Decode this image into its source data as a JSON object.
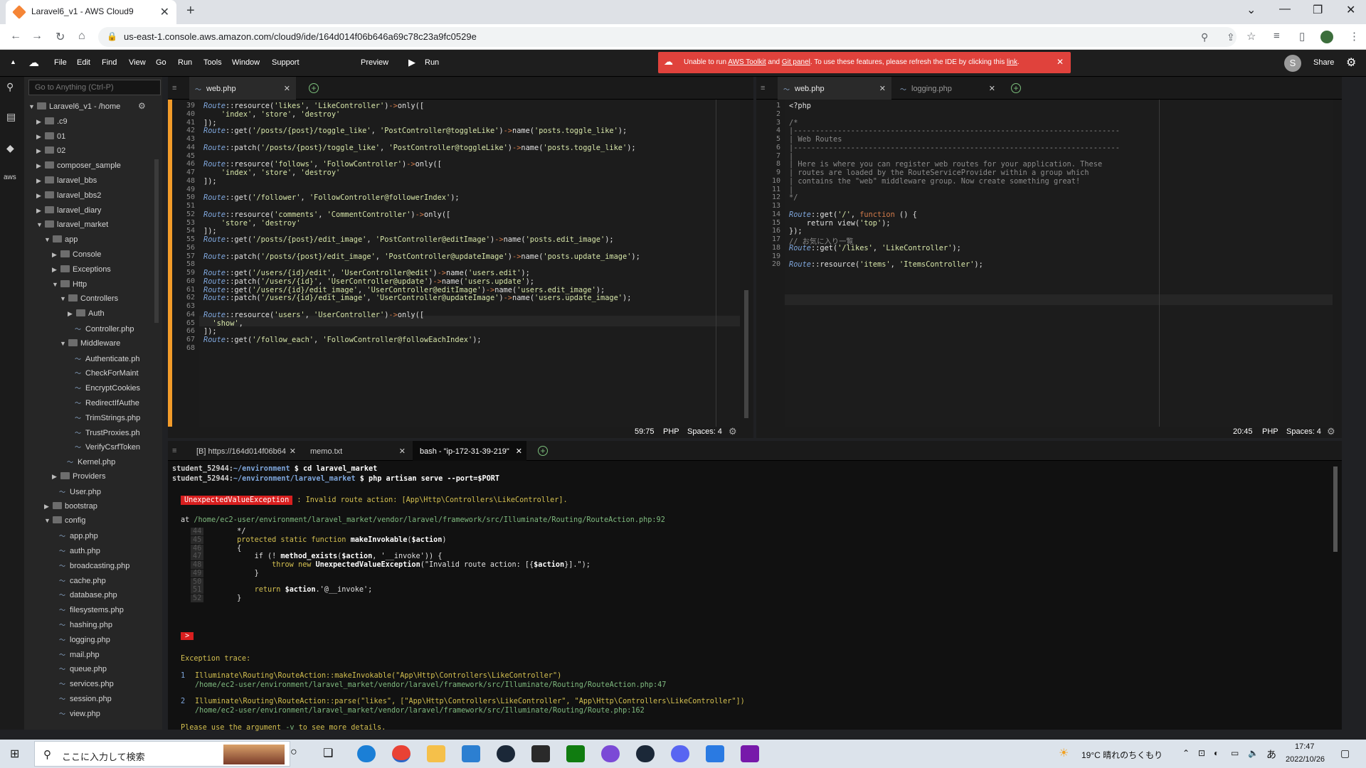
{
  "browser": {
    "tab_title": "Laravel6_v1 - AWS Cloud9",
    "url": "us-east-1.console.aws.amazon.com/cloud9/ide/164d014f06b646a69c78c23a9fc0529e"
  },
  "ide": {
    "menu": [
      "File",
      "Edit",
      "Find",
      "View",
      "Go",
      "Run",
      "Tools",
      "Window",
      "Support"
    ],
    "preview_label": "Preview",
    "run_label": "Run",
    "share_label": "Share",
    "avatar_letter": "S",
    "banner": {
      "prefix": "Unable to run ",
      "link1": "AWS Toolkit",
      "mid": " and ",
      "link2": "Git panel",
      "suffix": ". To use these features, please refresh the IDE by clicking this ",
      "link3": "link",
      "end": "."
    },
    "goto_placeholder": "Go to Anything (Ctrl-P)",
    "aws_label": "aws"
  },
  "tree": [
    {
      "label": "Laravel6_v1 - /home",
      "type": "folder",
      "depth": 0,
      "open": true
    },
    {
      "label": ".c9",
      "type": "folder",
      "depth": 1,
      "open": false
    },
    {
      "label": "01",
      "type": "folder",
      "depth": 1,
      "open": false
    },
    {
      "label": "02",
      "type": "folder",
      "depth": 1,
      "open": false
    },
    {
      "label": "composer_sample",
      "type": "folder",
      "depth": 1,
      "open": false
    },
    {
      "label": "laravel_bbs",
      "type": "folder",
      "depth": 1,
      "open": false
    },
    {
      "label": "laravel_bbs2",
      "type": "folder",
      "depth": 1,
      "open": false
    },
    {
      "label": "laravel_diary",
      "type": "folder",
      "depth": 1,
      "open": false
    },
    {
      "label": "laravel_market",
      "type": "folder",
      "depth": 1,
      "open": true
    },
    {
      "label": "app",
      "type": "folder",
      "depth": 2,
      "open": true
    },
    {
      "label": "Console",
      "type": "folder",
      "depth": 3,
      "open": false
    },
    {
      "label": "Exceptions",
      "type": "folder",
      "depth": 3,
      "open": false
    },
    {
      "label": "Http",
      "type": "folder",
      "depth": 3,
      "open": true
    },
    {
      "label": "Controllers",
      "type": "folder",
      "depth": 4,
      "open": true
    },
    {
      "label": "Auth",
      "type": "folder",
      "depth": 5,
      "open": false
    },
    {
      "label": "Controller.php",
      "type": "file",
      "depth": 5
    },
    {
      "label": "Middleware",
      "type": "folder",
      "depth": 4,
      "open": true
    },
    {
      "label": "Authenticate.ph",
      "type": "file",
      "depth": 5
    },
    {
      "label": "CheckForMaint",
      "type": "file",
      "depth": 5
    },
    {
      "label": "EncryptCookies",
      "type": "file",
      "depth": 5
    },
    {
      "label": "RedirectIfAuthe",
      "type": "file",
      "depth": 5
    },
    {
      "label": "TrimStrings.php",
      "type": "file",
      "depth": 5
    },
    {
      "label": "TrustProxies.ph",
      "type": "file",
      "depth": 5
    },
    {
      "label": "VerifyCsrfToken",
      "type": "file",
      "depth": 5
    },
    {
      "label": "Kernel.php",
      "type": "file",
      "depth": 4
    },
    {
      "label": "Providers",
      "type": "folder",
      "depth": 3,
      "open": false
    },
    {
      "label": "User.php",
      "type": "file",
      "depth": 3
    },
    {
      "label": "bootstrap",
      "type": "folder",
      "depth": 2,
      "open": false
    },
    {
      "label": "config",
      "type": "folder",
      "depth": 2,
      "open": true
    },
    {
      "label": "app.php",
      "type": "file",
      "depth": 3
    },
    {
      "label": "auth.php",
      "type": "file",
      "depth": 3
    },
    {
      "label": "broadcasting.php",
      "type": "file",
      "depth": 3
    },
    {
      "label": "cache.php",
      "type": "file",
      "depth": 3
    },
    {
      "label": "database.php",
      "type": "file",
      "depth": 3
    },
    {
      "label": "filesystems.php",
      "type": "file",
      "depth": 3
    },
    {
      "label": "hashing.php",
      "type": "file",
      "depth": 3
    },
    {
      "label": "logging.php",
      "type": "file",
      "depth": 3
    },
    {
      "label": "mail.php",
      "type": "file",
      "depth": 3
    },
    {
      "label": "queue.php",
      "type": "file",
      "depth": 3
    },
    {
      "label": "services.php",
      "type": "file",
      "depth": 3
    },
    {
      "label": "session.php",
      "type": "file",
      "depth": 3
    },
    {
      "label": "view.php",
      "type": "file",
      "depth": 3
    }
  ],
  "left_editor": {
    "tab": "web.php",
    "status": {
      "pos": "59:75",
      "lang": "PHP",
      "spaces": "Spaces: 4"
    },
    "lines": [
      {
        "n": "39",
        "t": "Route::resource('likes', 'LikeController')->only(["
      },
      {
        "n": "40",
        "t": "    'index', 'store', 'destroy'"
      },
      {
        "n": "41",
        "t": "]);"
      },
      {
        "n": "42",
        "t": "Route::get('/posts/{post}/toggle_like', 'PostController@toggleLike')->name('posts.toggle_like');"
      },
      {
        "n": "43",
        "t": ""
      },
      {
        "n": "44",
        "t": "Route::patch('/posts/{post}/toggle_like', 'PostController@toggleLike')->name('posts.toggle_like');"
      },
      {
        "n": "45",
        "t": ""
      },
      {
        "n": "46",
        "t": "Route::resource('follows', 'FollowController')->only(["
      },
      {
        "n": "47",
        "t": "    'index', 'store', 'destroy'"
      },
      {
        "n": "48",
        "t": "]);"
      },
      {
        "n": "49",
        "t": ""
      },
      {
        "n": "50",
        "t": "Route::get('/follower', 'FollowController@followerIndex');"
      },
      {
        "n": "51",
        "t": ""
      },
      {
        "n": "52",
        "t": "Route::resource('comments', 'CommentController')->only(["
      },
      {
        "n": "53",
        "t": "    'store', 'destroy'"
      },
      {
        "n": "54",
        "t": "]);"
      },
      {
        "n": "55",
        "t": "Route::get('/posts/{post}/edit_image', 'PostController@editImage')->name('posts.edit_image');"
      },
      {
        "n": "56",
        "t": ""
      },
      {
        "n": "57",
        "t": "Route::patch('/posts/{post}/edit_image', 'PostController@updateImage')->name('posts.update_image');"
      },
      {
        "n": "58",
        "t": ""
      },
      {
        "n": "59",
        "t": "Route::get('/users/{id}/edit', 'UserController@edit')->name('users.edit');"
      },
      {
        "n": "60",
        "t": "Route::patch('/users/{id}', 'UserController@update')->name('users.update');"
      },
      {
        "n": "61",
        "t": "Route::get('/users/{id}/edit_image', 'UserController@editImage')->name('users.edit_image');"
      },
      {
        "n": "62",
        "t": "Route::patch('/users/{id}/edit_image', 'UserController@updateImage')->name('users.update_image');"
      },
      {
        "n": "63",
        "t": ""
      },
      {
        "n": "64",
        "t": "Route::resource('users', 'UserController')->only(["
      },
      {
        "n": "65",
        "t": "  'show',"
      },
      {
        "n": "66",
        "t": "]);"
      },
      {
        "n": "67",
        "t": "Route::get('/follow_each', 'FollowController@followEachIndex');"
      },
      {
        "n": "68",
        "t": ""
      }
    ]
  },
  "right_editor": {
    "tabs": [
      "web.php",
      "logging.php"
    ],
    "status": {
      "pos": "20:45",
      "lang": "PHP",
      "spaces": "Spaces: 4"
    },
    "lines": [
      {
        "n": "1",
        "t": "<?php"
      },
      {
        "n": "2",
        "t": ""
      },
      {
        "n": "3",
        "t": "/*"
      },
      {
        "n": "4",
        "t": "|--------------------------------------------------------------------------"
      },
      {
        "n": "5",
        "t": "| Web Routes"
      },
      {
        "n": "6",
        "t": "|--------------------------------------------------------------------------"
      },
      {
        "n": "7",
        "t": "|"
      },
      {
        "n": "8",
        "t": "| Here is where you can register web routes for your application. These"
      },
      {
        "n": "9",
        "t": "| routes are loaded by the RouteServiceProvider within a group which"
      },
      {
        "n": "10",
        "t": "| contains the \"web\" middleware group. Now create something great!"
      },
      {
        "n": "11",
        "t": "|"
      },
      {
        "n": "12",
        "t": "*/"
      },
      {
        "n": "13",
        "t": ""
      },
      {
        "n": "14",
        "t": "Route::get('/', function () {"
      },
      {
        "n": "15",
        "t": "    return view('top');"
      },
      {
        "n": "16",
        "t": "});"
      },
      {
        "n": "17",
        "t": "// お気に入り一覧"
      },
      {
        "n": "18",
        "t": "Route::get('/likes', 'LikeController');"
      },
      {
        "n": "19",
        "t": ""
      },
      {
        "n": "20",
        "t": "Route::resource('items', 'ItemsController');"
      }
    ]
  },
  "terminal": {
    "tabs": [
      "[B] https://164d014f06b64",
      "memo.txt",
      "bash - \"ip-172-31-39-219\""
    ],
    "prompt1_user": "student_52944:",
    "prompt1_path": "~/environment",
    "prompt1_cmd": " $ cd laravel_market",
    "prompt2_user": "student_52944:",
    "prompt2_path": "~/environment/laravel_market",
    "prompt2_cmd": " $ php artisan serve --port=$PORT",
    "exception_badge": "UnexpectedValueException",
    "exception_msg": " : Invalid route action: [App\\Http\\Controllers\\LikeController].",
    "at_label": "at ",
    "at_path": "/home/ec2-user/environment/laravel_market/vendor/laravel/framework/src/Illuminate/Routing/RouteAction.php",
    "at_line": ":92",
    "snippet": [
      {
        "n": "44",
        "t": "        */"
      },
      {
        "n": "45",
        "t": "        protected static function makeInvokable($action)"
      },
      {
        "n": "46",
        "t": "        {"
      },
      {
        "n": "47",
        "t": "            if (! method_exists($action, '__invoke')) {"
      },
      {
        "n": "48",
        "t": "                throw new UnexpectedValueException(\"Invalid route action: [{$action}].\");"
      },
      {
        "n": "49",
        "t": "            }"
      },
      {
        "n": "50",
        "t": ""
      },
      {
        "n": "51",
        "t": "            return $action.'@__invoke';"
      },
      {
        "n": "52",
        "t": "        }"
      }
    ],
    "marker": ">",
    "trace_title": "Exception trace:",
    "trace": [
      {
        "i": "1",
        "call": "Illuminate\\Routing\\RouteAction::makeInvokable(\"App\\Http\\Controllers\\LikeController\")",
        "path": "/home/ec2-user/environment/laravel_market/vendor/laravel/framework/src/Illuminate/Routing/RouteAction.php",
        "line": ":47"
      },
      {
        "i": "2",
        "call": "Illuminate\\Routing\\RouteAction::parse(\"likes\", [\"App\\Http\\Controllers\\LikeController\", \"App\\Http\\Controllers\\LikeController\"])",
        "path": "/home/ec2-user/environment/laravel_market/vendor/laravel/framework/src/Illuminate/Routing/Route.php",
        "line": ":162"
      }
    ],
    "hint_pre": "Please use the argument ",
    "hint_arg": "-v",
    "hint_post": " to see more details."
  },
  "taskbar": {
    "search_placeholder": "ここに入力して検索",
    "weather": "19°C  晴れのちくもり",
    "time": "17:47",
    "date": "2022/10/26",
    "ime": "あ"
  },
  "colors": {
    "accent": "#e0423c",
    "code_bg": "#1c1c1c",
    "string": "#d6e5a8",
    "keyword": "#7fa7dd",
    "fn": "#ffffff"
  }
}
